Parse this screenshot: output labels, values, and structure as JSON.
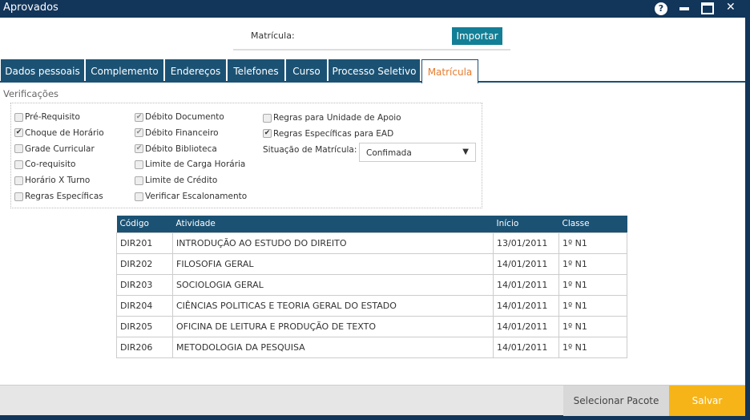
{
  "window": {
    "title": "Aprovados"
  },
  "header": {
    "matricula_label": "Matrícula:",
    "import_label": "Importar"
  },
  "tabs": [
    {
      "label": "Dados pessoais"
    },
    {
      "label": "Complemento"
    },
    {
      "label": "Endereços"
    },
    {
      "label": "Telefones"
    },
    {
      "label": "Curso"
    },
    {
      "label": "Processo Seletivo"
    },
    {
      "label": "Matrícula",
      "active": true
    }
  ],
  "verificacoes": {
    "title": "Verificações",
    "col1": [
      {
        "label": "Pré-Requisito",
        "checked": false
      },
      {
        "label": "Choque de Horário",
        "checked": true
      },
      {
        "label": "Grade Curricular",
        "checked": false
      },
      {
        "label": "Co-requisito",
        "checked": false
      },
      {
        "label": "Horário X Turno",
        "checked": false
      },
      {
        "label": "Regras Específicas",
        "checked": false
      }
    ],
    "col2": [
      {
        "label": "Débito Documento",
        "checked": true
      },
      {
        "label": "Débito Financeiro",
        "checked": true
      },
      {
        "label": "Débito Biblioteca",
        "checked": true
      },
      {
        "label": "Limite de Carga Horária",
        "checked": false
      },
      {
        "label": "Limite de Crédito",
        "checked": false
      },
      {
        "label": "Verificar Escalonamento",
        "checked": false
      }
    ],
    "col3": [
      {
        "label": "Regras para Unidade de Apoio",
        "checked": false
      },
      {
        "label": "Regras Específicas para EAD",
        "checked": true
      }
    ],
    "situacao_label": "Situação de Matrícula:",
    "situacao_value": "Confimada"
  },
  "table": {
    "headers": [
      "Código",
      "Atividade",
      "Início",
      "Classe"
    ],
    "rows": [
      [
        "DIR201",
        "INTRODUÇÃO AO ESTUDO DO DIREITO",
        "13/01/2011",
        "1º N1"
      ],
      [
        "DIR202",
        "FILOSOFIA GERAL",
        "14/01/2011",
        "1º N1"
      ],
      [
        "DIR203",
        "SOCIOLOGIA GERAL",
        "14/01/2011",
        "1º N1"
      ],
      [
        "DIR204",
        "CIÊNCIAS POLITICAS E TEORIA GERAL DO ESTADO",
        "14/01/2011",
        "1º N1"
      ],
      [
        "DIR205",
        "OFICINA DE LEITURA E PRODUÇÃO DE TEXTO",
        "14/01/2011",
        "1º N1"
      ],
      [
        "DIR206",
        "METODOLOGIA DA PESQUISA",
        "14/01/2011",
        "1º N1"
      ]
    ]
  },
  "footer": {
    "select_package": "Selecionar Pacote",
    "save": "Salvar"
  }
}
